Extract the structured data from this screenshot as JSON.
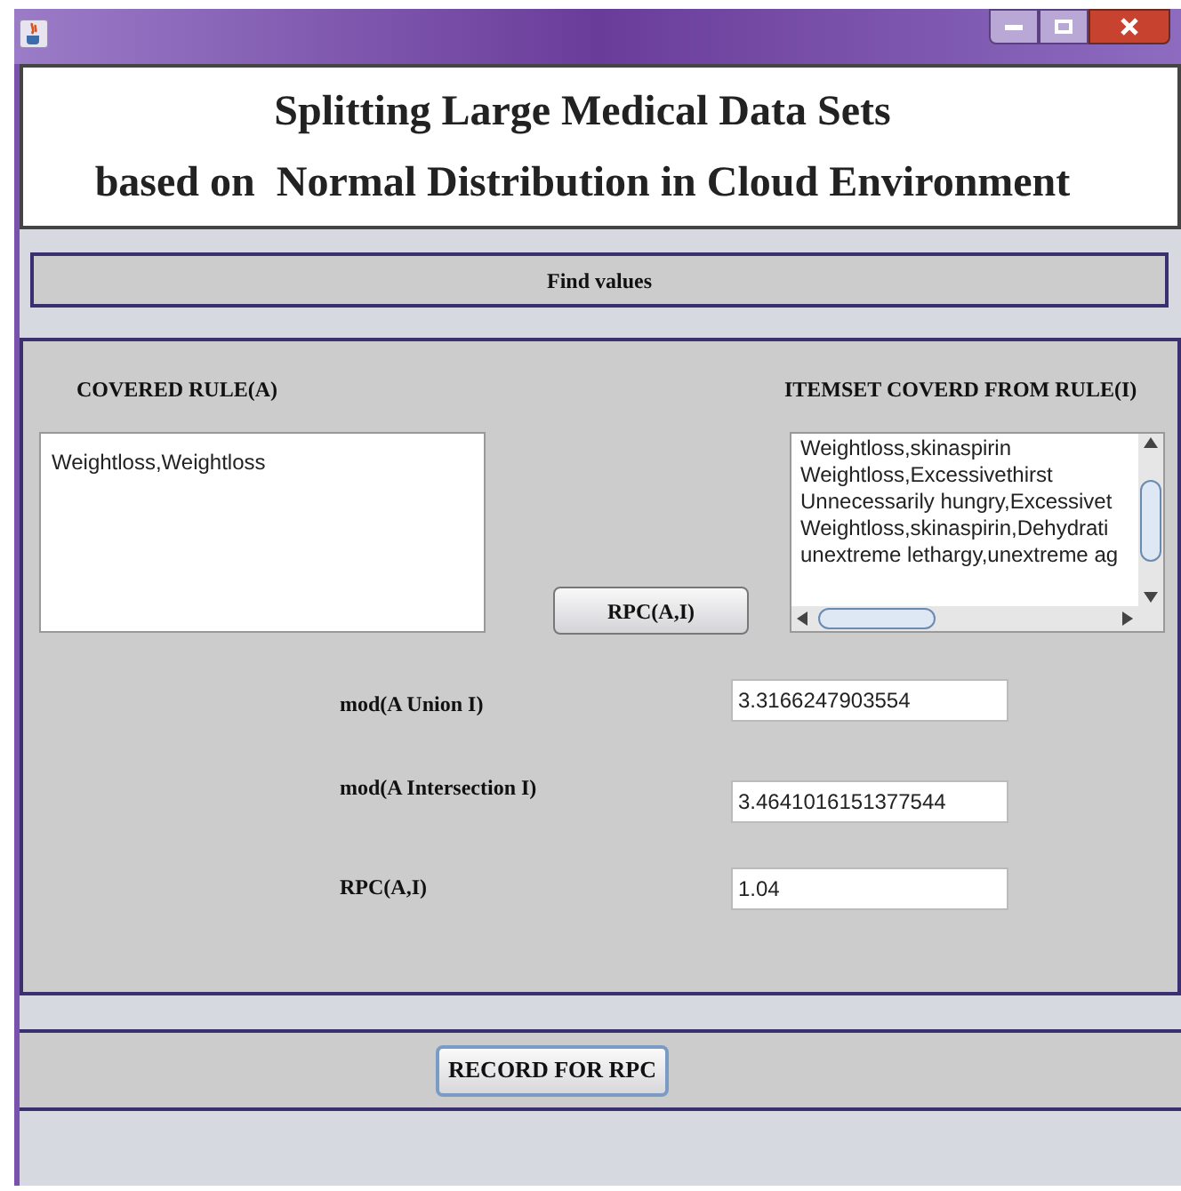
{
  "header": {
    "title_lines": [
      "Splitting Large Medical Data Sets",
      "based on  Normal Distribution in Cloud Environment"
    ]
  },
  "find_values_button": "Find values",
  "covered_rule": {
    "label": "COVERED RULE(A)",
    "text": "Weightloss,Weightloss"
  },
  "itemset": {
    "label": "ITEMSET COVERD FROM RULE(I)",
    "items": [
      "Weightloss,skinaspirin",
      "Weightloss,Excessivethirst",
      "Unnecessarily hungry,Excessivet",
      "Weightloss,skinaspirin,Dehydrati",
      "unextreme lethargy,unextreme ag"
    ]
  },
  "rpc_button": "RPC(A,I)",
  "results": [
    {
      "label": "mod(A Union I)",
      "value": "3.3166247903554"
    },
    {
      "label": "mod(A Intersection I)",
      "value": "3.4641016151377544"
    },
    {
      "label": "RPC(A,I)",
      "value": "1.04"
    }
  ],
  "record_button": "RECORD FOR RPC"
}
